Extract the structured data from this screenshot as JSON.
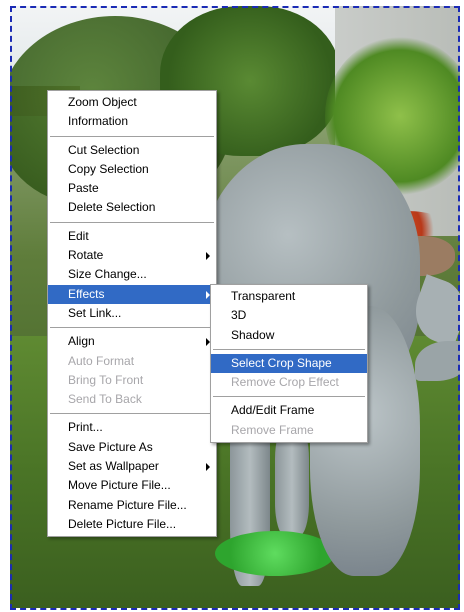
{
  "main_menu": {
    "items": [
      {
        "label": "Zoom Object"
      },
      {
        "label": "Information"
      },
      {
        "label": "Cut Selection"
      },
      {
        "label": "Copy Selection"
      },
      {
        "label": "Paste"
      },
      {
        "label": "Delete Selection"
      },
      {
        "label": "Edit"
      },
      {
        "label": "Rotate"
      },
      {
        "label": "Size Change..."
      },
      {
        "label": "Effects"
      },
      {
        "label": "Set Link..."
      },
      {
        "label": "Align"
      },
      {
        "label": "Auto Format"
      },
      {
        "label": "Bring To Front"
      },
      {
        "label": "Send To Back"
      },
      {
        "label": "Print..."
      },
      {
        "label": "Save Picture As"
      },
      {
        "label": "Set as Wallpaper"
      },
      {
        "label": "Move Picture File..."
      },
      {
        "label": "Rename Picture File..."
      },
      {
        "label": "Delete Picture File..."
      }
    ]
  },
  "effects_menu": {
    "items": [
      {
        "label": "Transparent"
      },
      {
        "label": "3D"
      },
      {
        "label": "Shadow"
      },
      {
        "label": "Select Crop Shape"
      },
      {
        "label": "Remove Crop Effect"
      },
      {
        "label": "Add/Edit Frame"
      },
      {
        "label": "Remove Frame"
      }
    ]
  },
  "colors": {
    "highlight": "#316ac5",
    "disabled_text": "#a7a6aa",
    "selection_border": "#1b2bb5"
  },
  "icons": [
    "submenu-arrow-icon"
  ]
}
